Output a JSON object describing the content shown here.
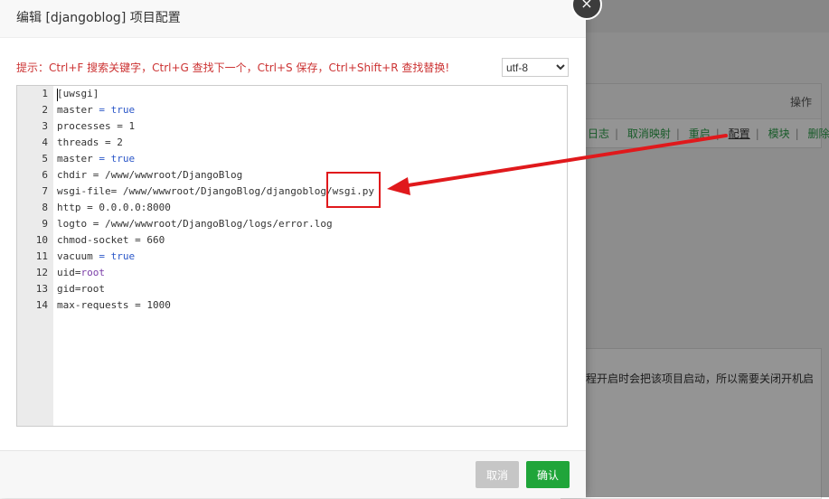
{
  "background": {
    "panel_header": "操作",
    "actions": [
      "日志",
      "取消映射",
      "重启",
      "配置",
      "模块",
      "删除"
    ],
    "note": "程开启时会把该项目启动，所以需要关闭开机启"
  },
  "modal": {
    "title": "编辑 [djangoblog] 项目配置",
    "close_label": "×",
    "hint": "提示：Ctrl+F 搜索关键字，Ctrl+G 查找下一个，Ctrl+S 保存，Ctrl+Shift+R 查找替换!",
    "encoding": {
      "selected": "utf-8",
      "options": [
        "utf-8"
      ]
    },
    "cancel_label": "取消",
    "ok_label": "确认"
  },
  "editor": {
    "lines": [
      {
        "num": "1",
        "parts": [
          {
            "t": "[uwsgi]",
            "c": "op"
          }
        ]
      },
      {
        "num": "2",
        "parts": [
          {
            "t": "master ",
            "c": "op"
          },
          {
            "t": "=",
            "c": "kw"
          },
          {
            "t": " ",
            "c": "op"
          },
          {
            "t": "true",
            "c": "kw"
          }
        ]
      },
      {
        "num": "3",
        "parts": [
          {
            "t": "processes = 1",
            "c": "op"
          }
        ]
      },
      {
        "num": "4",
        "parts": [
          {
            "t": "threads = 2",
            "c": "op"
          }
        ]
      },
      {
        "num": "5",
        "parts": [
          {
            "t": "master ",
            "c": "op"
          },
          {
            "t": "=",
            "c": "kw"
          },
          {
            "t": " ",
            "c": "op"
          },
          {
            "t": "true",
            "c": "kw"
          }
        ]
      },
      {
        "num": "6",
        "parts": [
          {
            "t": "chdir = /www/wwwroot/DjangoBlog",
            "c": "op"
          }
        ]
      },
      {
        "num": "7",
        "parts": [
          {
            "t": "wsgi-file= /www/wwwroot/DjangoBlog/djangoblog/wsgi.py",
            "c": "op"
          }
        ]
      },
      {
        "num": "8",
        "parts": [
          {
            "t": "http = 0.0.0.0:8000",
            "c": "op"
          }
        ]
      },
      {
        "num": "9",
        "parts": [
          {
            "t": "logto = /www/wwwroot/DjangoBlog/logs/error.log",
            "c": "op"
          }
        ]
      },
      {
        "num": "10",
        "parts": [
          {
            "t": "chmod-socket = 660",
            "c": "op"
          }
        ]
      },
      {
        "num": "11",
        "parts": [
          {
            "t": "vacuum ",
            "c": "op"
          },
          {
            "t": "=",
            "c": "kw"
          },
          {
            "t": " ",
            "c": "op"
          },
          {
            "t": "true",
            "c": "kw"
          }
        ]
      },
      {
        "num": "12",
        "parts": [
          {
            "t": "uid=",
            "c": "op"
          },
          {
            "t": "root",
            "c": "val"
          }
        ]
      },
      {
        "num": "13",
        "parts": [
          {
            "t": "gid=root",
            "c": "op"
          }
        ]
      },
      {
        "num": "14",
        "parts": [
          {
            "t": "max-requests = 1000",
            "c": "op"
          }
        ]
      }
    ]
  },
  "colors": {
    "accent_green": "#20a53a",
    "annotation_red": "#e0191c",
    "hint_red": "#cc3333",
    "keyword_blue": "#2b57c8"
  }
}
